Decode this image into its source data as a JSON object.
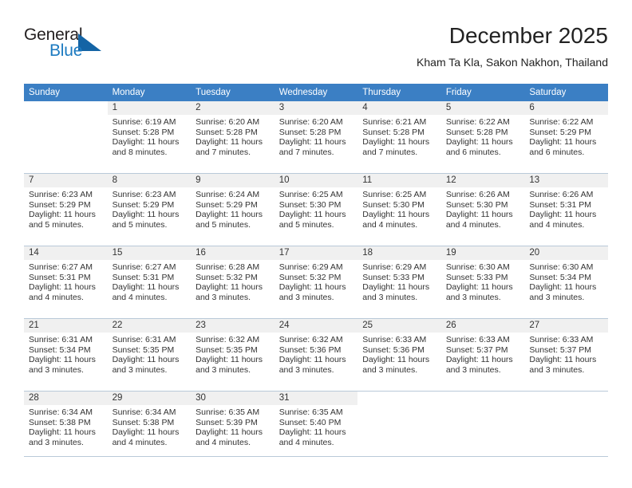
{
  "brand": {
    "word1": "General",
    "word2": "Blue",
    "triangle_color": "#1464a5",
    "blue_color": "#1c7ac0"
  },
  "header": {
    "title": "December 2025",
    "subtitle": "Kham Ta Kla, Sakon Nakhon, Thailand"
  },
  "theme": {
    "header_row_bg": "#3b7fc4",
    "daynum_band_bg": "#f0f0f0",
    "grid_line": "#b9c9d8"
  },
  "weekday_headers": [
    "Sunday",
    "Monday",
    "Tuesday",
    "Wednesday",
    "Thursday",
    "Friday",
    "Saturday"
  ],
  "weeks": [
    [
      {
        "day": "",
        "sunrise": "",
        "sunset": "",
        "daylight1": "",
        "daylight2": "",
        "blank": true
      },
      {
        "day": "1",
        "sunrise": "Sunrise: 6:19 AM",
        "sunset": "Sunset: 5:28 PM",
        "daylight1": "Daylight: 11 hours",
        "daylight2": "and 8 minutes."
      },
      {
        "day": "2",
        "sunrise": "Sunrise: 6:20 AM",
        "sunset": "Sunset: 5:28 PM",
        "daylight1": "Daylight: 11 hours",
        "daylight2": "and 7 minutes."
      },
      {
        "day": "3",
        "sunrise": "Sunrise: 6:20 AM",
        "sunset": "Sunset: 5:28 PM",
        "daylight1": "Daylight: 11 hours",
        "daylight2": "and 7 minutes."
      },
      {
        "day": "4",
        "sunrise": "Sunrise: 6:21 AM",
        "sunset": "Sunset: 5:28 PM",
        "daylight1": "Daylight: 11 hours",
        "daylight2": "and 7 minutes."
      },
      {
        "day": "5",
        "sunrise": "Sunrise: 6:22 AM",
        "sunset": "Sunset: 5:28 PM",
        "daylight1": "Daylight: 11 hours",
        "daylight2": "and 6 minutes."
      },
      {
        "day": "6",
        "sunrise": "Sunrise: 6:22 AM",
        "sunset": "Sunset: 5:29 PM",
        "daylight1": "Daylight: 11 hours",
        "daylight2": "and 6 minutes."
      }
    ],
    [
      {
        "day": "7",
        "sunrise": "Sunrise: 6:23 AM",
        "sunset": "Sunset: 5:29 PM",
        "daylight1": "Daylight: 11 hours",
        "daylight2": "and 5 minutes."
      },
      {
        "day": "8",
        "sunrise": "Sunrise: 6:23 AM",
        "sunset": "Sunset: 5:29 PM",
        "daylight1": "Daylight: 11 hours",
        "daylight2": "and 5 minutes."
      },
      {
        "day": "9",
        "sunrise": "Sunrise: 6:24 AM",
        "sunset": "Sunset: 5:29 PM",
        "daylight1": "Daylight: 11 hours",
        "daylight2": "and 5 minutes."
      },
      {
        "day": "10",
        "sunrise": "Sunrise: 6:25 AM",
        "sunset": "Sunset: 5:30 PM",
        "daylight1": "Daylight: 11 hours",
        "daylight2": "and 5 minutes."
      },
      {
        "day": "11",
        "sunrise": "Sunrise: 6:25 AM",
        "sunset": "Sunset: 5:30 PM",
        "daylight1": "Daylight: 11 hours",
        "daylight2": "and 4 minutes."
      },
      {
        "day": "12",
        "sunrise": "Sunrise: 6:26 AM",
        "sunset": "Sunset: 5:30 PM",
        "daylight1": "Daylight: 11 hours",
        "daylight2": "and 4 minutes."
      },
      {
        "day": "13",
        "sunrise": "Sunrise: 6:26 AM",
        "sunset": "Sunset: 5:31 PM",
        "daylight1": "Daylight: 11 hours",
        "daylight2": "and 4 minutes."
      }
    ],
    [
      {
        "day": "14",
        "sunrise": "Sunrise: 6:27 AM",
        "sunset": "Sunset: 5:31 PM",
        "daylight1": "Daylight: 11 hours",
        "daylight2": "and 4 minutes."
      },
      {
        "day": "15",
        "sunrise": "Sunrise: 6:27 AM",
        "sunset": "Sunset: 5:31 PM",
        "daylight1": "Daylight: 11 hours",
        "daylight2": "and 4 minutes."
      },
      {
        "day": "16",
        "sunrise": "Sunrise: 6:28 AM",
        "sunset": "Sunset: 5:32 PM",
        "daylight1": "Daylight: 11 hours",
        "daylight2": "and 3 minutes."
      },
      {
        "day": "17",
        "sunrise": "Sunrise: 6:29 AM",
        "sunset": "Sunset: 5:32 PM",
        "daylight1": "Daylight: 11 hours",
        "daylight2": "and 3 minutes."
      },
      {
        "day": "18",
        "sunrise": "Sunrise: 6:29 AM",
        "sunset": "Sunset: 5:33 PM",
        "daylight1": "Daylight: 11 hours",
        "daylight2": "and 3 minutes."
      },
      {
        "day": "19",
        "sunrise": "Sunrise: 6:30 AM",
        "sunset": "Sunset: 5:33 PM",
        "daylight1": "Daylight: 11 hours",
        "daylight2": "and 3 minutes."
      },
      {
        "day": "20",
        "sunrise": "Sunrise: 6:30 AM",
        "sunset": "Sunset: 5:34 PM",
        "daylight1": "Daylight: 11 hours",
        "daylight2": "and 3 minutes."
      }
    ],
    [
      {
        "day": "21",
        "sunrise": "Sunrise: 6:31 AM",
        "sunset": "Sunset: 5:34 PM",
        "daylight1": "Daylight: 11 hours",
        "daylight2": "and 3 minutes."
      },
      {
        "day": "22",
        "sunrise": "Sunrise: 6:31 AM",
        "sunset": "Sunset: 5:35 PM",
        "daylight1": "Daylight: 11 hours",
        "daylight2": "and 3 minutes."
      },
      {
        "day": "23",
        "sunrise": "Sunrise: 6:32 AM",
        "sunset": "Sunset: 5:35 PM",
        "daylight1": "Daylight: 11 hours",
        "daylight2": "and 3 minutes."
      },
      {
        "day": "24",
        "sunrise": "Sunrise: 6:32 AM",
        "sunset": "Sunset: 5:36 PM",
        "daylight1": "Daylight: 11 hours",
        "daylight2": "and 3 minutes."
      },
      {
        "day": "25",
        "sunrise": "Sunrise: 6:33 AM",
        "sunset": "Sunset: 5:36 PM",
        "daylight1": "Daylight: 11 hours",
        "daylight2": "and 3 minutes."
      },
      {
        "day": "26",
        "sunrise": "Sunrise: 6:33 AM",
        "sunset": "Sunset: 5:37 PM",
        "daylight1": "Daylight: 11 hours",
        "daylight2": "and 3 minutes."
      },
      {
        "day": "27",
        "sunrise": "Sunrise: 6:33 AM",
        "sunset": "Sunset: 5:37 PM",
        "daylight1": "Daylight: 11 hours",
        "daylight2": "and 3 minutes."
      }
    ],
    [
      {
        "day": "28",
        "sunrise": "Sunrise: 6:34 AM",
        "sunset": "Sunset: 5:38 PM",
        "daylight1": "Daylight: 11 hours",
        "daylight2": "and 3 minutes."
      },
      {
        "day": "29",
        "sunrise": "Sunrise: 6:34 AM",
        "sunset": "Sunset: 5:38 PM",
        "daylight1": "Daylight: 11 hours",
        "daylight2": "and 4 minutes."
      },
      {
        "day": "30",
        "sunrise": "Sunrise: 6:35 AM",
        "sunset": "Sunset: 5:39 PM",
        "daylight1": "Daylight: 11 hours",
        "daylight2": "and 4 minutes."
      },
      {
        "day": "31",
        "sunrise": "Sunrise: 6:35 AM",
        "sunset": "Sunset: 5:40 PM",
        "daylight1": "Daylight: 11 hours",
        "daylight2": "and 4 minutes."
      },
      {
        "day": "",
        "sunrise": "",
        "sunset": "",
        "daylight1": "",
        "daylight2": "",
        "blank": true
      },
      {
        "day": "",
        "sunrise": "",
        "sunset": "",
        "daylight1": "",
        "daylight2": "",
        "blank": true
      },
      {
        "day": "",
        "sunrise": "",
        "sunset": "",
        "daylight1": "",
        "daylight2": "",
        "blank": true
      }
    ]
  ]
}
